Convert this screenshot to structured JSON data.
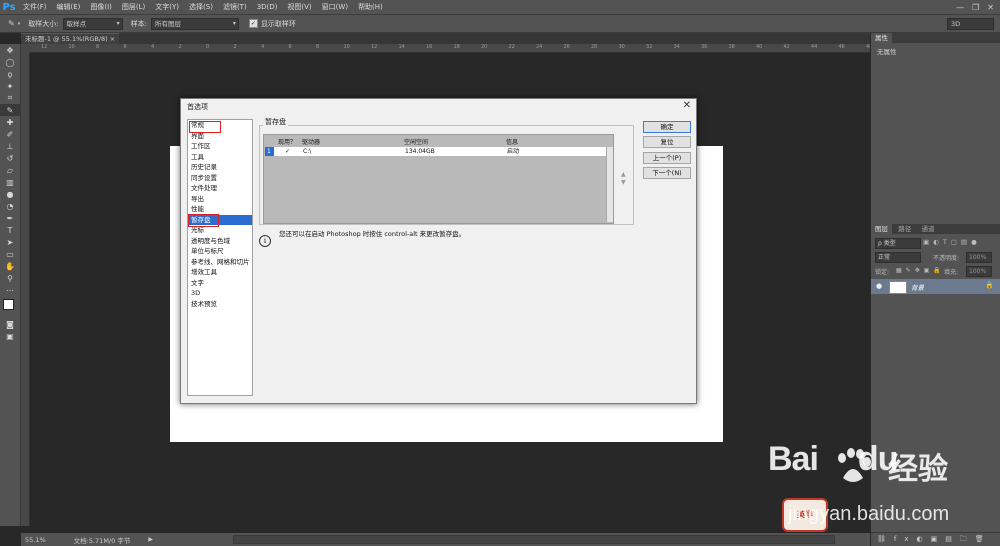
{
  "app": {
    "logo": "Ps"
  },
  "menu": [
    "文件(F)",
    "编辑(E)",
    "图像(I)",
    "图层(L)",
    "文字(Y)",
    "选择(S)",
    "滤镜(T)",
    "3D(D)",
    "视图(V)",
    "窗口(W)",
    "帮助(H)"
  ],
  "options": {
    "sample_size_label": "取样大小:",
    "sample_size_value": "取样点",
    "sample_label": "样本:",
    "sample_value": "所有图层",
    "show_ring_label": "显示取样环",
    "workspace": "3D"
  },
  "document": {
    "tab": "未标题-1 @ 55.1%(RGB/8) ×",
    "status_zoom": "55.1%",
    "status_doc": "文档:5.71M/0 字节"
  },
  "ruler": [
    "12",
    "10",
    "8",
    "6",
    "4",
    "2",
    "0",
    "2",
    "4",
    "6",
    "8",
    "10",
    "12",
    "14",
    "16",
    "18",
    "20",
    "22",
    "24",
    "26",
    "28",
    "30",
    "32",
    "34",
    "36",
    "38",
    "40",
    "42",
    "44",
    "46",
    "48"
  ],
  "properties": {
    "tab": "属性",
    "empty": "无属性"
  },
  "layers_panel": {
    "tabs": [
      "图层",
      "路径",
      "通道"
    ],
    "filter": "ρ 类型",
    "blend_mode": "正常",
    "opacity_label": "不透明度:",
    "opacity_value": "100%",
    "lock_label": "锁定:",
    "fill_label": "填充:",
    "fill_value": "100%",
    "layer_name": "背景"
  },
  "dialog": {
    "title": "首选项",
    "categories": [
      "常规",
      "界面",
      "工作区",
      "工具",
      "历史记录",
      "同步设置",
      "文件处理",
      "导出",
      "性能",
      "暂存盘",
      "光标",
      "透明度与色域",
      "单位与标尺",
      "参考线、网格和切片",
      "增效工具",
      "文字",
      "3D",
      "技术预览"
    ],
    "selected_index": 9,
    "group_label": "暂存盘",
    "columns": [
      "现用？",
      "驱动器",
      "空闲空间",
      "信息"
    ],
    "row": {
      "index": "1",
      "check": "✓",
      "drive": "C:\\",
      "free": "134.04GB",
      "info": "启动"
    },
    "info_text": "您还可以在启动 Photoshop 时按住 control-alt 来更改暂存盘。",
    "buttons": {
      "ok": "确定",
      "reset": "复位",
      "prev": "上一个(P)",
      "next": "下一个(N)"
    }
  },
  "watermark": {
    "brand": "Bai",
    "brand2": "du",
    "product": "经验",
    "url": "jingyan.baidu.com",
    "badge": "英半"
  }
}
